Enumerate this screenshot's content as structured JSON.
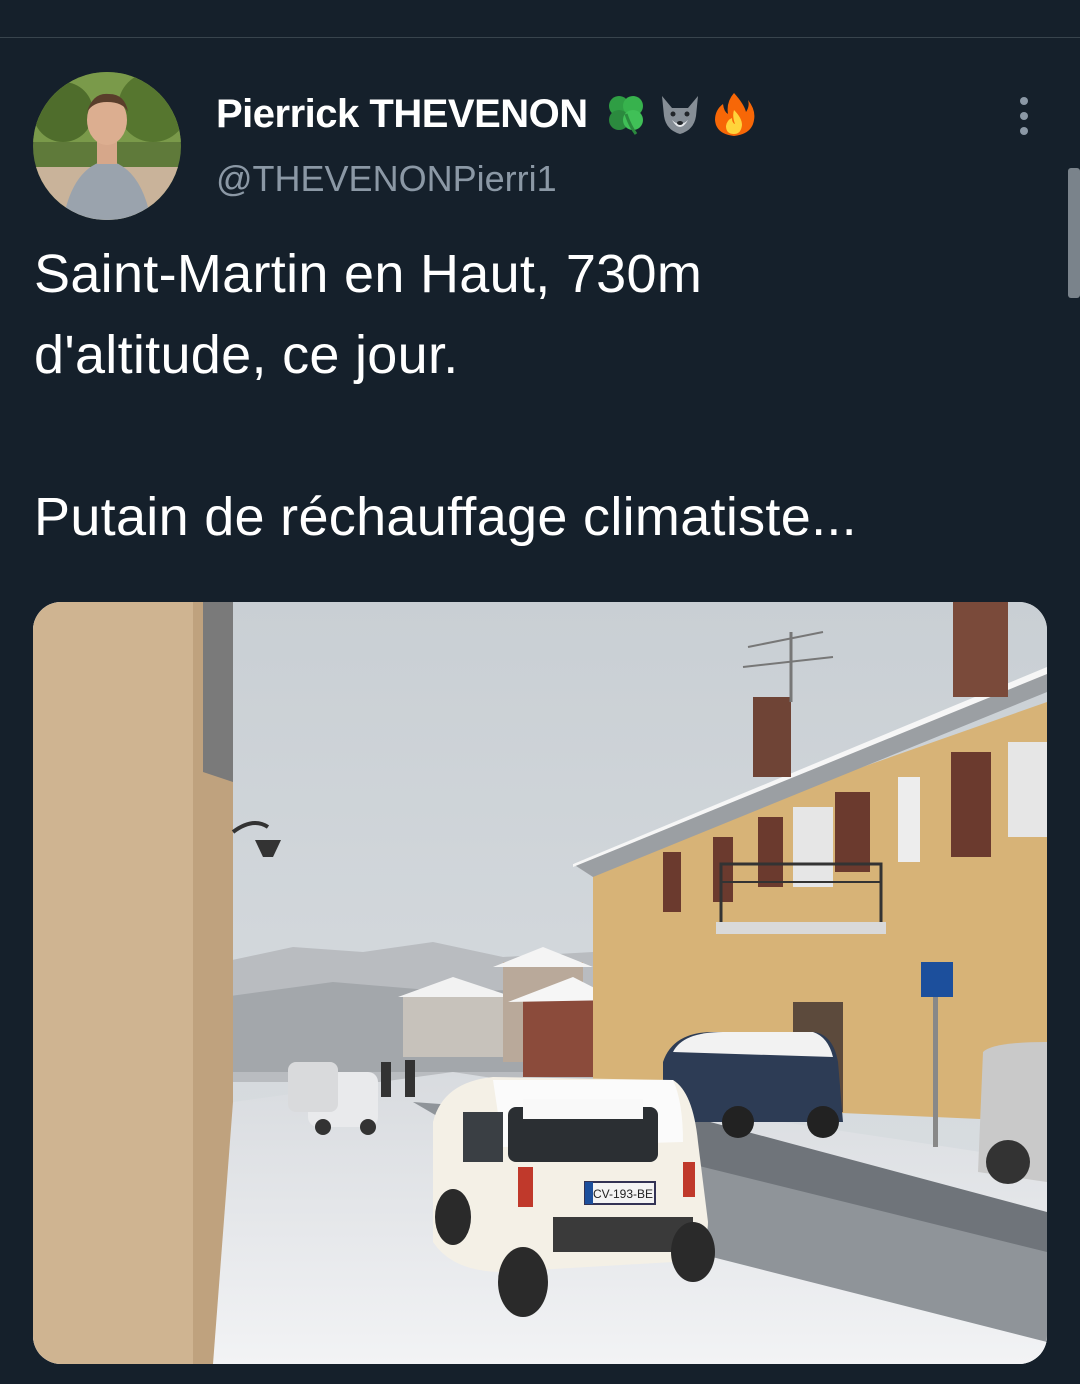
{
  "tweet": {
    "author": {
      "display_name": "Pierrick THEVENON",
      "handle": "@THEVENONPierri1",
      "name_emojis": [
        "four-leaf-clover-icon",
        "wolf-face-icon",
        "fire-icon"
      ]
    },
    "text": "Saint-Martin en Haut, 730m\nd'altitude, ce jour.\n\nPutain de réchauffage climatiste...",
    "media": {
      "type": "photo",
      "plate_text": "CV-193-BE"
    },
    "more_menu_icon": "more-options-icon"
  },
  "colors": {
    "background": "#15202b",
    "text_primary": "#ffffff",
    "text_secondary": "#8b98a5",
    "divider": "#38444d"
  }
}
